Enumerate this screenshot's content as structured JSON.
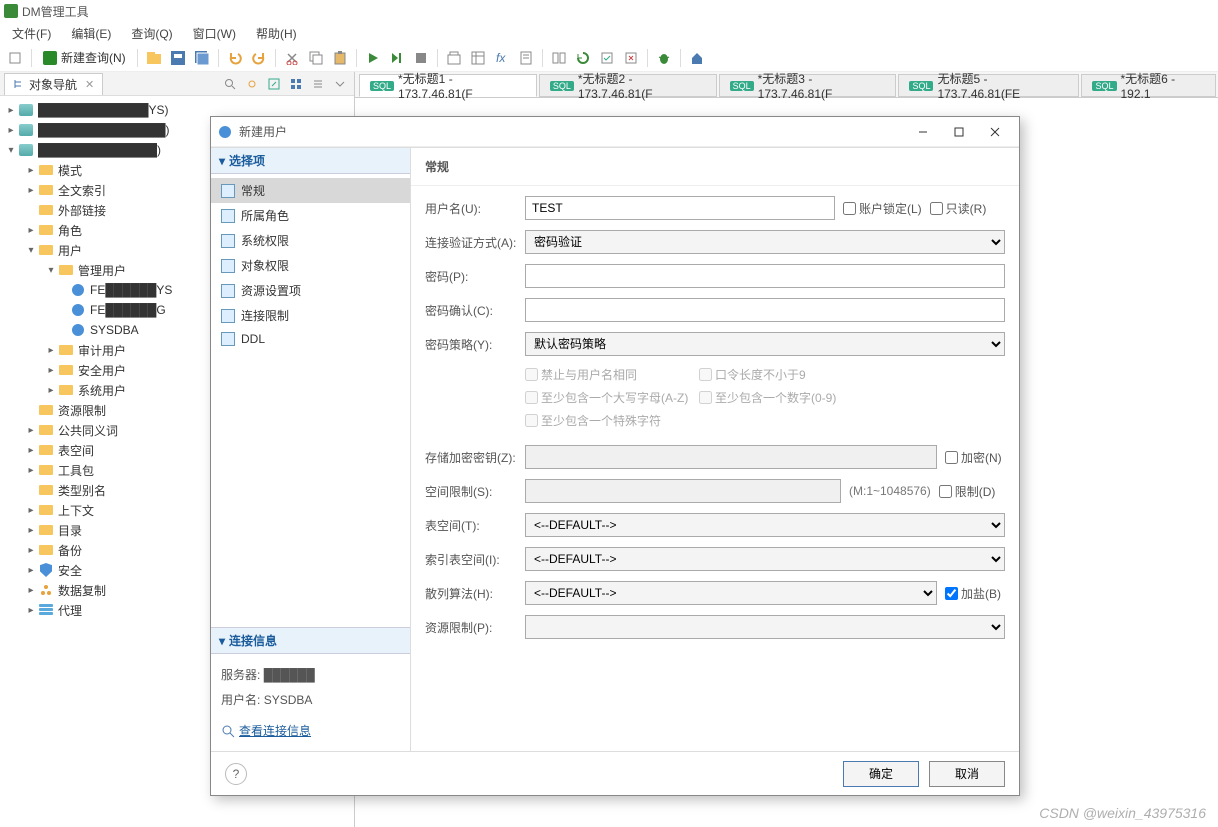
{
  "app": {
    "title": "DM管理工具"
  },
  "menu": {
    "file": "文件(F)",
    "edit": "编辑(E)",
    "query": "查询(Q)",
    "window": "窗口(W)",
    "help": "帮助(H)"
  },
  "toolbar": {
    "new_query": "新建查询(N)"
  },
  "objnav": {
    "tab_label": "对象导航"
  },
  "tree": {
    "conn1": "█████████████YS)",
    "conn2": "███████████████)",
    "conn3": "██████████████)",
    "mode": "模式",
    "fulltext": "全文索引",
    "extlink": "外部链接",
    "role": "角色",
    "user": "用户",
    "mgmt_user": "管理用户",
    "u1": "FE██████YS",
    "u2": "FE██████G",
    "u3": "SYSDBA",
    "audit_user": "审计用户",
    "sec_user": "安全用户",
    "sys_user": "系统用户",
    "res_limit": "资源限制",
    "synonym": "公共同义词",
    "tablespace": "表空间",
    "toolkit": "工具包",
    "type_alias": "类型别名",
    "context": "上下文",
    "catalog": "目录",
    "backup": "备份",
    "security": "安全",
    "replication": "数据复制",
    "agent": "代理"
  },
  "tabs": {
    "t1": "*无标题1 - 173.7.46.81(F",
    "t2": "*无标题2 - 173.7.46.81(F",
    "t3": "*无标题3 - 173.7.46.81(F",
    "t5": "无标题5 - 173.7.46.81(FE",
    "t6": "*无标题6 - 192.1"
  },
  "dialog": {
    "title": "新建用户",
    "nav_section": "选择项",
    "nav": {
      "general": "常规",
      "roles": "所属角色",
      "sys_priv": "系统权限",
      "obj_priv": "对象权限",
      "resource": "资源设置项",
      "conn_limit": "连接限制",
      "ddl": "DDL"
    },
    "conn_section": "连接信息",
    "conn": {
      "server_label": "服务器:",
      "server_value": "██████",
      "user_label": "用户名:",
      "user_value": "SYSDBA",
      "view_link": "查看连接信息"
    },
    "form_title": "常规",
    "form": {
      "username_label": "用户名(U):",
      "username_value": "TEST",
      "lock_label": "账户锁定(L)",
      "readonly_label": "只读(R)",
      "auth_label": "连接验证方式(A):",
      "auth_value": "密码验证",
      "pwd_label": "密码(P):",
      "pwd_confirm_label": "密码确认(C):",
      "policy_label": "密码策略(Y):",
      "policy_value": "默认密码策略",
      "opt_same": "禁止与用户名相同",
      "opt_len9": "口令长度不小于9",
      "opt_upper": "至少包含一个大写字母(A-Z)",
      "opt_digit": "至少包含一个数字(0-9)",
      "opt_special": "至少包含一个特殊字符",
      "storekey_label": "存储加密密钥(Z):",
      "encrypt_label": "加密(N)",
      "space_label": "空间限制(S):",
      "space_hint": "(M:1~1048576)",
      "limit_label": "限制(D)",
      "ts_label": "表空间(T):",
      "ts_value": "<--DEFAULT-->",
      "its_label": "索引表空间(I):",
      "its_value": "<--DEFAULT-->",
      "hash_label": "散列算法(H):",
      "hash_value": "<--DEFAULT-->",
      "salt_label": "加盐(B)",
      "reslimit_label": "资源限制(P):"
    },
    "footer": {
      "ok": "确定",
      "cancel": "取消"
    }
  },
  "watermark": "CSDN @weixin_43975316"
}
